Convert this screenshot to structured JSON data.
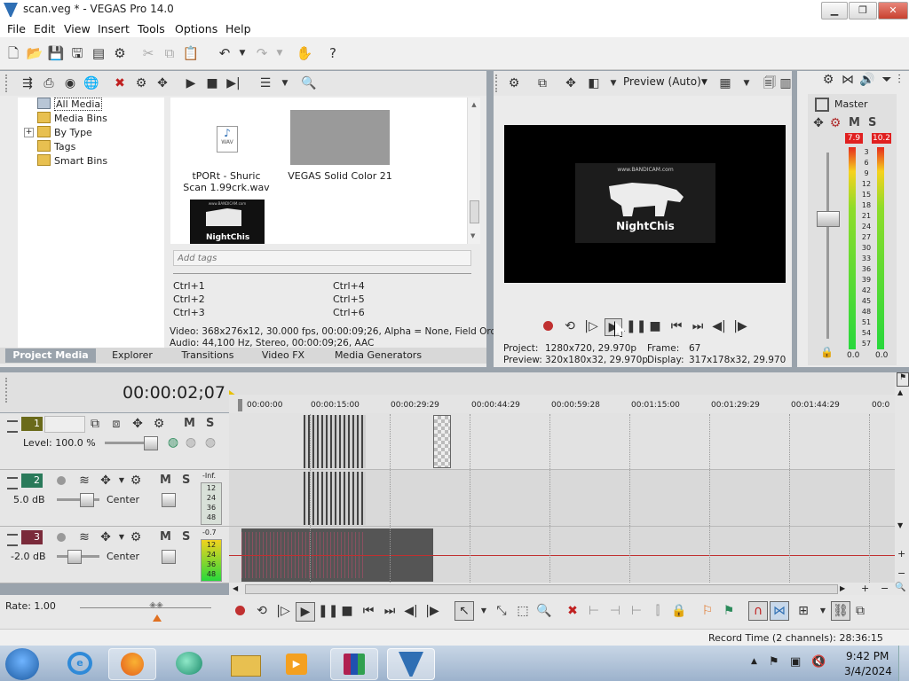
{
  "window": {
    "title": "scan.veg * - VEGAS Pro 14.0",
    "minimize": "▁",
    "maximize": "❐",
    "close": "✕"
  },
  "menu": [
    "File",
    "Edit",
    "View",
    "Insert",
    "Tools",
    "Options",
    "Help"
  ],
  "media_tree": {
    "items": [
      "All Media",
      "Media Bins",
      "By Type",
      "Tags",
      "Smart Bins"
    ],
    "expand": "+"
  },
  "media_items": [
    {
      "name": "tPORt - Shuric Scan 1.99crk.wav",
      "badge": "WAV"
    },
    {
      "name": "VEGAS Solid Color 21"
    }
  ],
  "thumb_text": {
    "site": "www.BANDICAM.com",
    "brand": "NightChis"
  },
  "tags": {
    "placeholder": "Add tags",
    "shortcuts": [
      "Ctrl+1",
      "Ctrl+4",
      "Ctrl+2",
      "Ctrl+5",
      "Ctrl+3",
      "Ctrl+6"
    ]
  },
  "media_info": {
    "video": "Video: 368x276x12, 30.000 fps, 00:00:09;26, Alpha = None, Field Order",
    "audio": "Audio: 44,100 Hz, Stereo, 00:00:09;26, AAC"
  },
  "tabs": [
    "Project Media",
    "Explorer",
    "Transitions",
    "Video FX",
    "Media Generators"
  ],
  "preview": {
    "quality": "Preview (Auto)",
    "project_label": "Project:",
    "project": "1280x720, 29.970p",
    "preview_label": "Preview:",
    "preview": "320x180x32, 29.970p",
    "frame_label": "Frame:",
    "frame": "67",
    "display_label": "Display:",
    "display": "317x178x32, 29.970",
    "screen_site": "www.BANDICAM.com",
    "screen_brand": "NightChis"
  },
  "master": {
    "label": "Master",
    "m": "M",
    "s": "S",
    "peak_left": "7.9",
    "peak_right": "10.2",
    "scale": [
      "3",
      "6",
      "9",
      "12",
      "15",
      "18",
      "21",
      "24",
      "27",
      "30",
      "33",
      "36",
      "39",
      "42",
      "45",
      "48",
      "51",
      "54",
      "57"
    ],
    "value_left": "0.0",
    "value_right": "0.0",
    "fader_level": 0.0
  },
  "timeline": {
    "timecode": "00:00:02;07",
    "ruler": [
      "00:00:00",
      "00:00:15:00",
      "00:00:29:29",
      "00:00:44:29",
      "00:00:59:28",
      "00:01:15:00",
      "00:01:29:29",
      "00:01:44:29",
      "00:0"
    ],
    "rate": "Rate: 1.00",
    "record_time": "Record Time (2 channels): 28:36:15"
  },
  "tracks": [
    {
      "num": "1",
      "type": "video",
      "level": "Level: 100.0 %",
      "m": "M",
      "s": "S"
    },
    {
      "num": "2",
      "type": "audio",
      "vol": "5.0 dB",
      "pan": "Center",
      "m": "M",
      "s": "S",
      "peak": "-Inf.",
      "scale": [
        "12",
        "24",
        "36",
        "48"
      ]
    },
    {
      "num": "3",
      "type": "audio",
      "vol": "-2.0 dB",
      "pan": "Center",
      "m": "M",
      "s": "S",
      "peak": "-0.7",
      "scale": [
        "12",
        "24",
        "36",
        "48"
      ]
    }
  ],
  "clock": {
    "time": "9:42 PM",
    "date": "3/4/2024"
  },
  "colors": {
    "accent": "#2f6fb4",
    "meter_red": "#e02020",
    "track_video": "#6a6a1a",
    "track_audio2": "#2a7a5a",
    "track_audio3": "#7a2a3a"
  }
}
